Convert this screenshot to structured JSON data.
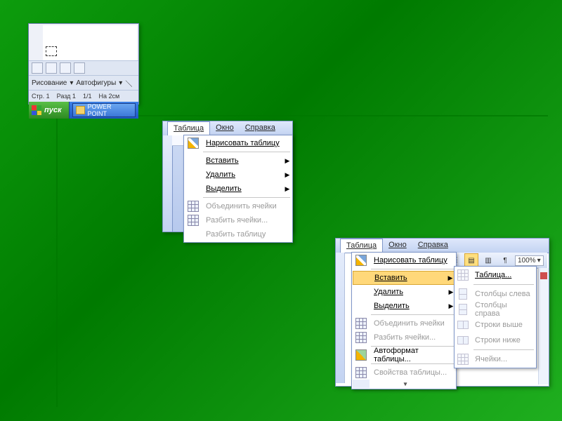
{
  "shot1": {
    "drawing_label": "Рисование",
    "autoshapes_label": "Автофигуры",
    "status": {
      "page": "Стр. 1",
      "section": "Разд 1",
      "pos": "1/1",
      "at": "На 2см"
    },
    "start_label": "пуск",
    "task_label": "POWER POINT"
  },
  "menubar": {
    "table": "Таблица",
    "window": "Окно",
    "help": "Справка"
  },
  "menu": {
    "draw_table": "Нарисовать таблицу",
    "insert": "Вставить",
    "delete": "Удалить",
    "select": "Выделить",
    "merge_cells": "Объединить ячейки",
    "split_cells": "Разбить ячейки...",
    "split_table": "Разбить таблицу",
    "autoformat": "Автоформат таблицы...",
    "properties": "Свойства таблицы..."
  },
  "submenu_insert": {
    "table": "Таблица...",
    "cols_left": "Столбцы слева",
    "cols_right": "Столбцы справа",
    "rows_above": "Строки выше",
    "rows_below": "Строки ниже",
    "cells": "Ячейки..."
  },
  "shot3": {
    "zoom": "100%",
    "pilcrow": "¶"
  }
}
